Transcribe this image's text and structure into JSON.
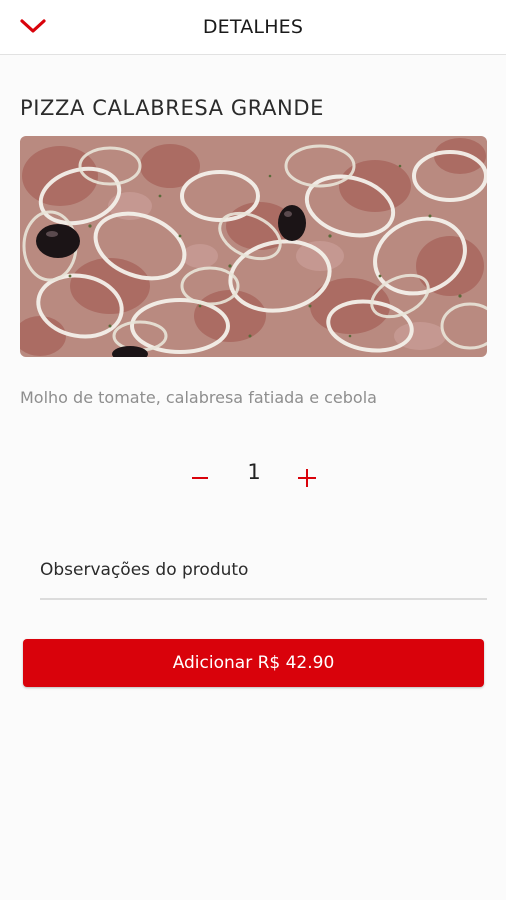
{
  "header": {
    "title": "DETALHES",
    "back_icon": "chevron-down-icon"
  },
  "product": {
    "name": "PIZZA CALABRESA GRANDE",
    "description": "Molho de tomate, calabresa fatiada e cebola"
  },
  "quantity": {
    "minus_symbol": "−",
    "value": "1",
    "plus_symbol": "+"
  },
  "notes": {
    "placeholder": "Observações do produto"
  },
  "add_button": {
    "label": "Adicionar R$ 42.90"
  },
  "colors": {
    "accent": "#d9020b",
    "description_text": "#8e8e8e"
  }
}
